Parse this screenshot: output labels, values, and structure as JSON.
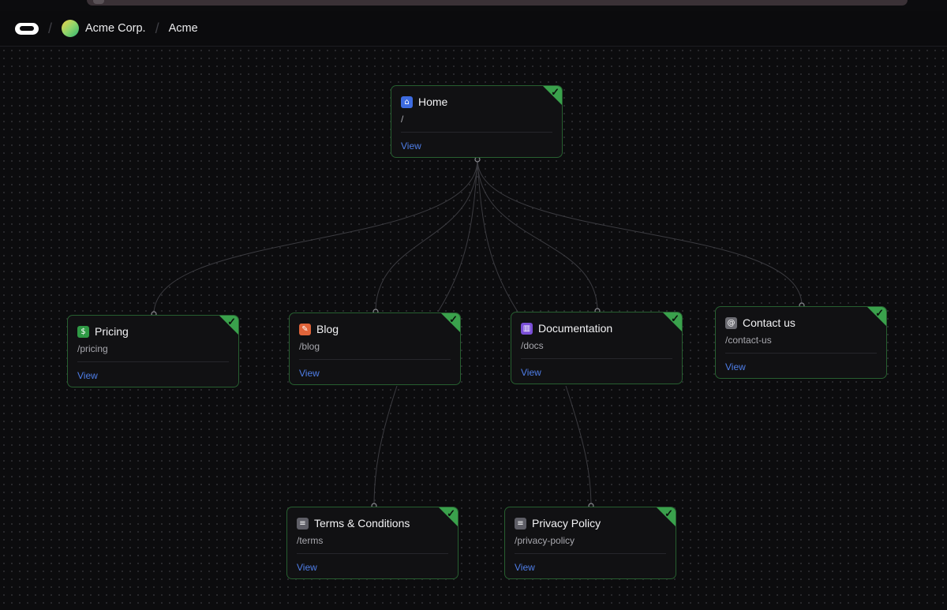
{
  "header": {
    "team_name": "Acme Corp.",
    "project_name": "Acme",
    "separator": "/"
  },
  "icons": {
    "home": "house-icon",
    "pricing": "dollar-icon",
    "blog": "pencil-icon",
    "docs": "book-icon",
    "contact": "at-icon",
    "terms": "document-icon",
    "privacy": "document-icon"
  },
  "colors": {
    "node_border": "#275f30",
    "status_corner": "#3aa14c",
    "link": "#4f7ee8"
  },
  "nodes": {
    "home": {
      "title": "Home",
      "path": "/",
      "view": "View"
    },
    "pricing": {
      "title": "Pricing",
      "path": "/pricing",
      "view": "View"
    },
    "blog": {
      "title": "Blog",
      "path": "/blog",
      "view": "View"
    },
    "docs": {
      "title": "Documentation",
      "path": "/docs",
      "view": "View"
    },
    "contact": {
      "title": "Contact us",
      "path": "/contact-us",
      "view": "View"
    },
    "terms": {
      "title": "Terms & Conditions",
      "path": "/terms",
      "view": "View"
    },
    "privacy": {
      "title": "Privacy Policy",
      "path": "/privacy-policy",
      "view": "View"
    }
  },
  "edges": [
    [
      "home",
      "pricing"
    ],
    [
      "home",
      "blog"
    ],
    [
      "home",
      "docs"
    ],
    [
      "home",
      "contact"
    ],
    [
      "home",
      "blog"
    ],
    [
      "home",
      "docs"
    ],
    [
      "blog",
      "terms"
    ],
    [
      "docs",
      "privacy"
    ]
  ]
}
